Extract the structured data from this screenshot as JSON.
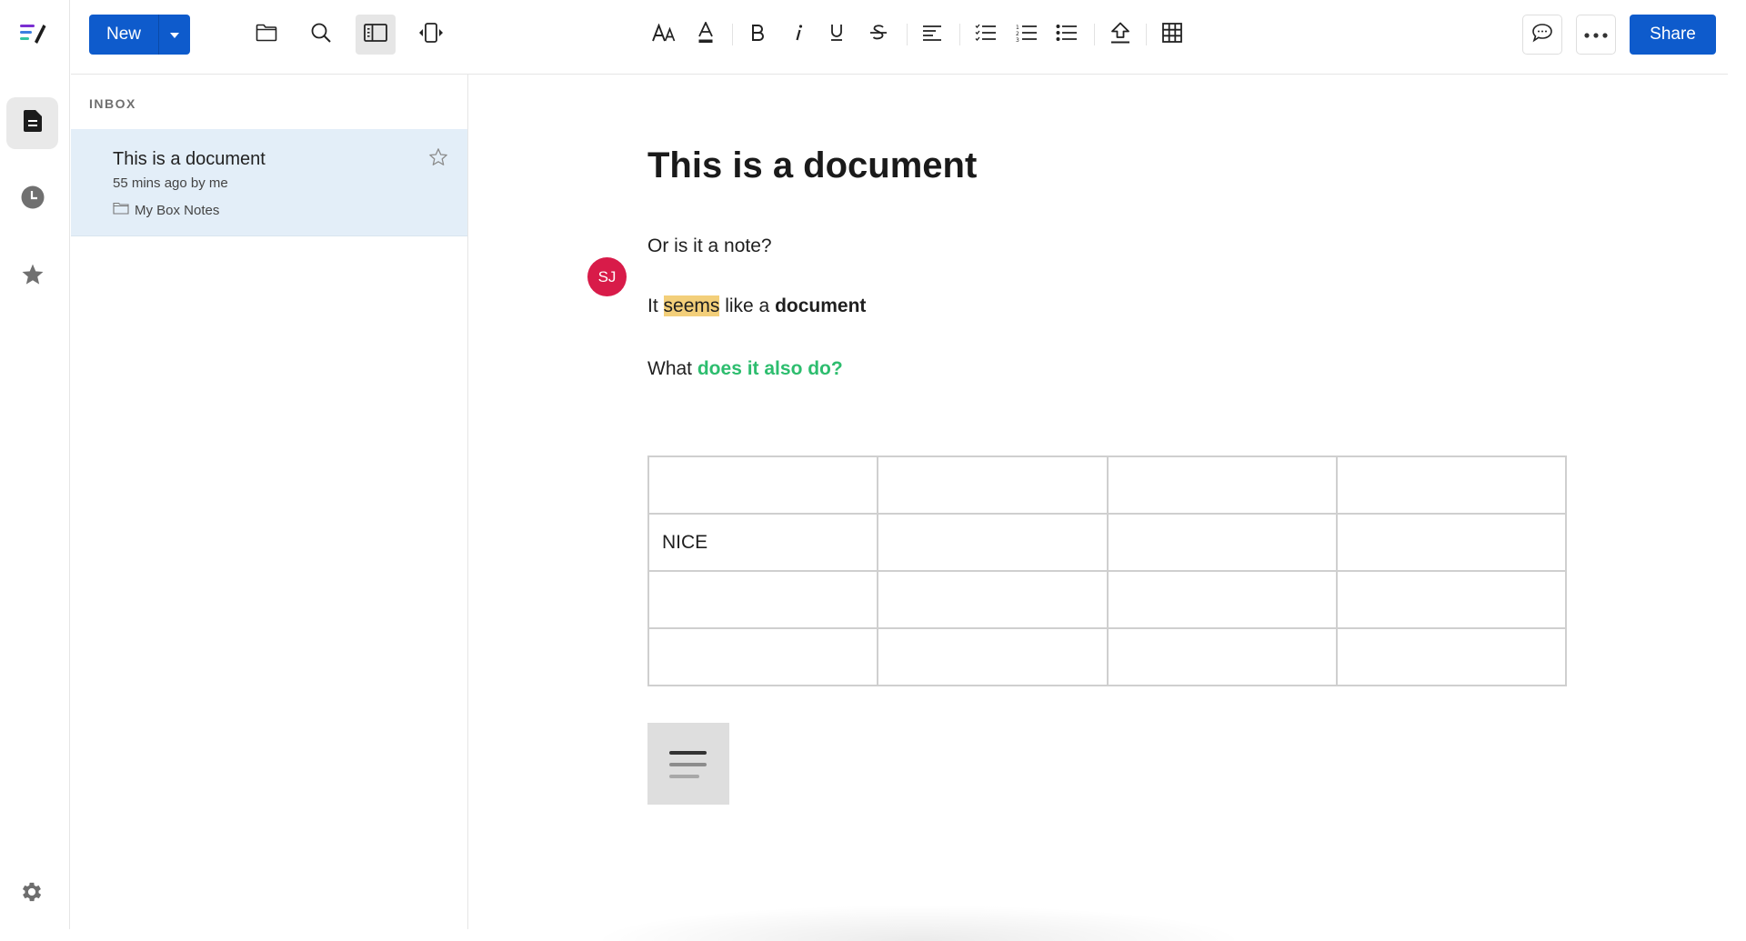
{
  "app": {
    "logo": "box-notes-logo",
    "colors": {
      "primary": "#0e5bcc",
      "list_selected_bg": "#e3eef8",
      "avatar_bg": "#d81b49",
      "highlight": "#f3cf7a",
      "green_text": "#2dbd6e"
    }
  },
  "rail": {
    "items": [
      {
        "name": "notes",
        "icon": "document-icon",
        "active": true
      },
      {
        "name": "recents",
        "icon": "clock-icon",
        "active": false
      },
      {
        "name": "favorites",
        "icon": "star-icon",
        "active": false
      }
    ],
    "settings_icon": "gear-icon"
  },
  "toolbar": {
    "new_label": "New",
    "new_dropdown_icon": "caret-down-icon",
    "nav_icons": [
      "folder-icon",
      "search-icon",
      "sidebar-toggle-icon",
      "expand-width-icon"
    ],
    "format_icons": [
      "text-size-icon",
      "text-color-icon",
      "bold-icon",
      "italic-icon",
      "underline-icon",
      "strikethrough-icon",
      "align-left-icon",
      "checklist-icon",
      "numbered-list-icon",
      "bulleted-list-icon",
      "upload-icon",
      "table-icon"
    ],
    "comment_icon": "comment-icon",
    "more_icon": "more-icon",
    "share_label": "Share"
  },
  "list": {
    "section_label": "INBOX",
    "items": [
      {
        "title": "This is a document",
        "meta": "55 mins ago by me",
        "folder": "My Box Notes",
        "starred": false,
        "selected": true
      }
    ]
  },
  "document": {
    "title": "This is a document",
    "avatar_initials": "SJ",
    "paragraphs": {
      "p1": "Or is it a note?",
      "p2": {
        "t1": "It ",
        "highlighted": "seems",
        "t2": " like a ",
        "bold": "document"
      },
      "p3": {
        "t1": "What ",
        "green": "does it also do?"
      }
    },
    "table": {
      "rows": [
        [
          "",
          "",
          "",
          ""
        ],
        [
          "NICE",
          "",
          "",
          ""
        ],
        [
          "",
          "",
          "",
          ""
        ],
        [
          "",
          "",
          "",
          ""
        ]
      ]
    },
    "embed_icon": "text-block-icon"
  }
}
